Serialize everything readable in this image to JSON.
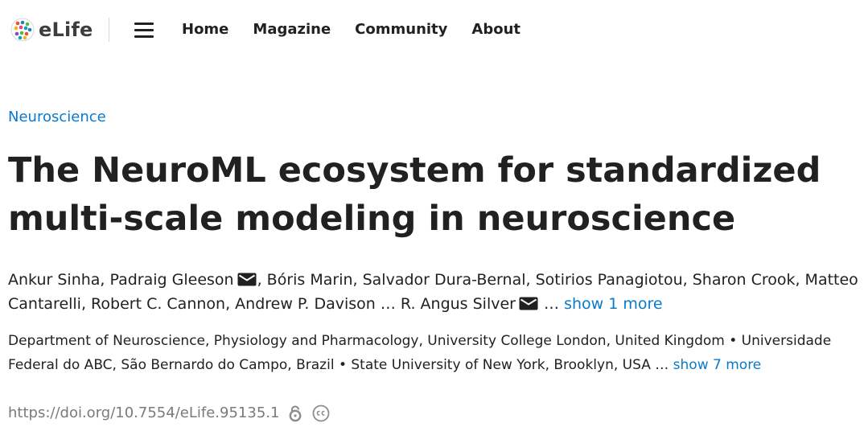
{
  "header": {
    "logo_text": "eLife",
    "menu_icon": "hamburger-menu-icon",
    "nav": [
      "Home",
      "Magazine",
      "Community",
      "About"
    ]
  },
  "article": {
    "subject": "Neuroscience",
    "title": "The NeuroML ecosystem for standardized multi-scale modeling in neuroscience",
    "authors": {
      "part1": "Ankur Sinha, Padraig Gleeson",
      "part2": ", Bóris Marin, Salvador Dura-Bernal, Sotirios Panagiotou, Sharon Crook, Matteo Cantarelli, Robert C. Cannon, Andrew P. Davison … R. Angus Silver",
      "part3": " …",
      "show_more": "show 1 more"
    },
    "affiliations": {
      "text": "Department of Neuroscience, Physiology and Pharmacology, University College London, United Kingdom • Universidade Federal do ABC, São Bernardo do Campo, Brazil • State University of New York, Brooklyn, USA …",
      "show_more": "show 7 more"
    },
    "doi": "https://doi.org/10.7554/eLife.95135.1",
    "icons": {
      "open_access": "open-access-lock-icon",
      "license": "creative-commons-icon",
      "email": "mail-icon"
    }
  },
  "colors": {
    "accent": "#087acc",
    "text": "#212121",
    "muted": "#7a7a7a"
  }
}
